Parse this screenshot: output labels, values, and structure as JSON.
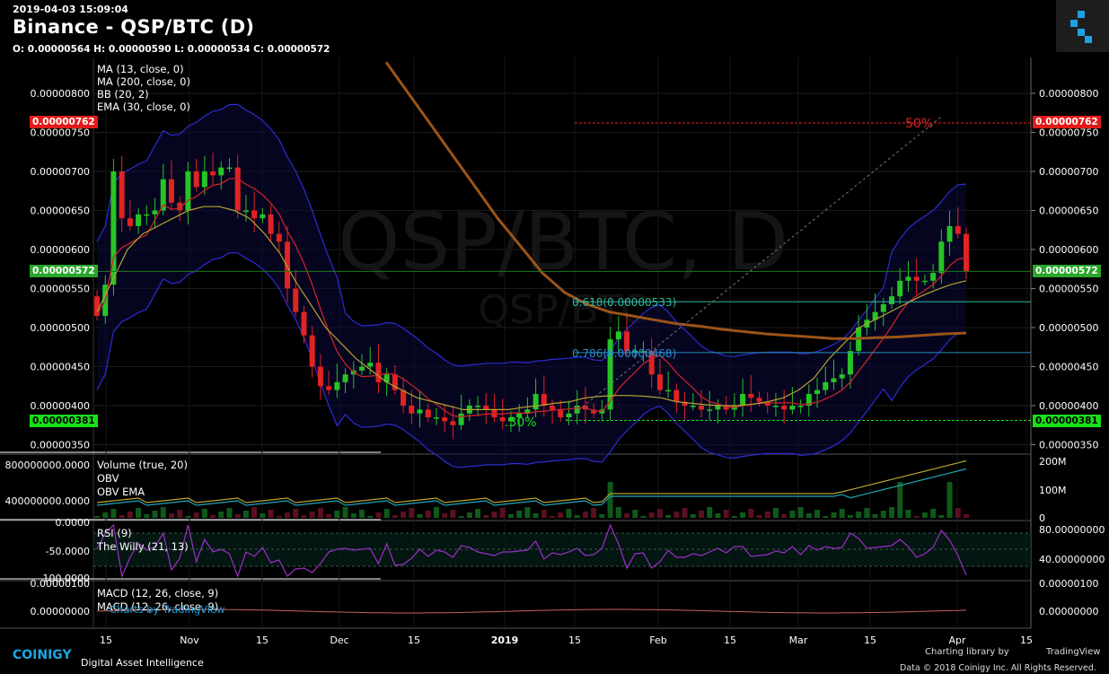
{
  "header": {
    "timestamp": "2019-04-03 15:09:04",
    "title": "Binance - QSP/BTC (D)",
    "ohlc": "O: 0.00000564 H: 0.00000590 L: 0.00000534 C: 0.00000572"
  },
  "watermark": {
    "main": "QSP/BTC, D",
    "sub": "QSP/BTC"
  },
  "legend": {
    "main": [
      "MA (13, close, 0)",
      "MA (200, close, 0)",
      "BB (20, 2)",
      "EMA (30, close, 0)"
    ],
    "volume": [
      "Volume (true, 20)",
      "OBV",
      "OBV EMA"
    ],
    "rsi": [
      "RSI (9)",
      "The Willy (21, 13)"
    ],
    "macd": [
      "MACD (12, 26, close, 9)",
      "MACD (12, 26, close, 9)"
    ]
  },
  "tags": {
    "resistance": "0.00000762",
    "last": "0.00000572",
    "support": "0.00000381",
    "fib_top_pct": "50%",
    "fib_618": "0.618(0.00000533)",
    "fib_786": "0.786(0.00000468)",
    "fib_bottom_pct": ".30%"
  },
  "watermark_small": "Charts by TradingView",
  "footer": {
    "brand": "COINIGY",
    "tagline": "Digital Asset Intelligence",
    "library": "Charting library by",
    "tv": "TradingView",
    "copyright": "Data © 2018   Coinigy Inc. All Rights Reserved."
  },
  "colors": {
    "up": "#26c426",
    "down": "#e02323",
    "ma13": "#c8232a",
    "ma200": "#9b5418",
    "bb": "#2c2cd4",
    "ema30": "#b8a430",
    "fib": "#2a8fb8",
    "rsi": "#9b2fc9",
    "obv_ema": "#20a6b8",
    "obv": "#b8a430"
  },
  "chart_data": [
    {
      "type": "candlestick",
      "title": "Binance - QSP/BTC (D)",
      "y_unit": "BTC",
      "ylim": [
        3.4e-06,
        8.4e-06
      ],
      "y_ticks": [
        "0.00000350",
        "0.00000400",
        "0.00000450",
        "0.00000500",
        "0.00000550",
        "0.00000600",
        "0.00000650",
        "0.00000700",
        "0.00000750",
        "0.00000800"
      ],
      "x_ticks": [
        "15",
        "Nov",
        "15",
        "Dec",
        "15",
        "2019",
        "15",
        "Feb",
        "15",
        "Mar",
        "15",
        "Apr",
        "15"
      ],
      "close": [
        515,
        555,
        700,
        640,
        630,
        645,
        645,
        650,
        690,
        660,
        650,
        700,
        680,
        700,
        695,
        705,
        705,
        650,
        650,
        640,
        645,
        620,
        610,
        550,
        520,
        490,
        450,
        425,
        420,
        430,
        440,
        445,
        450,
        455,
        430,
        440,
        420,
        400,
        390,
        395,
        385,
        385,
        380,
        375,
        390,
        400,
        400,
        395,
        385,
        380,
        385,
        390,
        395,
        415,
        400,
        395,
        385,
        390,
        400,
        395,
        390,
        395,
        485,
        495,
        470,
        470,
        470,
        440,
        420,
        420,
        405,
        400,
        400,
        395,
        395,
        400,
        395,
        400,
        415,
        410,
        405,
        400,
        400,
        395,
        400,
        400,
        415,
        420,
        430,
        435,
        440,
        470,
        500,
        510,
        520,
        530,
        540,
        560,
        565,
        560,
        560,
        570,
        610,
        630,
        620,
        572
      ],
      "series": [
        {
          "name": "MA (200, close, 0)",
          "points": [
            [
              30,
              840
            ],
            [
              40,
              800
            ],
            [
              50,
              760
            ],
            [
              60,
              720
            ],
            [
              70,
              680
            ],
            [
              80,
              640
            ],
            [
              90,
              605
            ],
            [
              100,
              570
            ],
            [
              105,
              545
            ],
            [
              110,
              530
            ],
            [
              115,
              520
            ],
            [
              120,
              515
            ],
            [
              125,
              510
            ],
            [
              130,
              505
            ],
            [
              135,
              502
            ],
            [
              140,
              498
            ],
            [
              145,
              495
            ],
            [
              150,
              492
            ],
            [
              155,
              490
            ],
            [
              160,
              488
            ],
            [
              165,
              486
            ],
            [
              170,
              486
            ],
            [
              175,
              487
            ],
            [
              180,
              488
            ],
            [
              185,
              490
            ],
            [
              190,
              492
            ],
            [
              195,
              493
            ]
          ]
        },
        {
          "name": "EMA (30, close, 0)",
          "values": [
            520,
            560,
            600,
            620,
            630,
            640,
            650,
            655,
            655,
            650,
            640,
            620,
            595,
            560,
            530,
            500,
            480,
            460,
            445,
            430,
            420,
            410,
            405,
            400,
            395,
            395,
            395,
            395,
            398,
            400,
            403,
            405,
            410,
            412,
            413,
            413,
            412,
            410,
            405,
            403,
            401,
            400,
            400,
            402,
            405,
            410,
            420,
            435,
            460,
            480,
            500,
            510,
            520,
            530,
            540,
            548,
            555,
            560
          ]
        }
      ],
      "annotations": {
        "resistance": 7.62e-06,
        "last": 5.72e-06,
        "support": 3.81e-06,
        "fib_618": 5.33e-06,
        "fib_786": 4.68e-06
      }
    },
    {
      "type": "bar",
      "title": "Volume (true, 20)",
      "y_ticks_left": [
        "800000000.0000",
        "400000000.0000"
      ],
      "y_ticks_right": [
        "200M",
        "100M",
        "0"
      ]
    },
    {
      "type": "line",
      "title": "RSI (9)",
      "y_ticks_left": [
        "0.0000",
        "-50.0000",
        "-100.0000"
      ],
      "y_ticks_right": [
        "80.00000000",
        "40.00000000"
      ]
    },
    {
      "type": "line",
      "title": "MACD (12, 26, close, 9)",
      "y_ticks_left": [
        "0.00000100",
        "0.00000000"
      ],
      "y_ticks_right": [
        "0.00000100",
        "0.00000000"
      ]
    }
  ]
}
